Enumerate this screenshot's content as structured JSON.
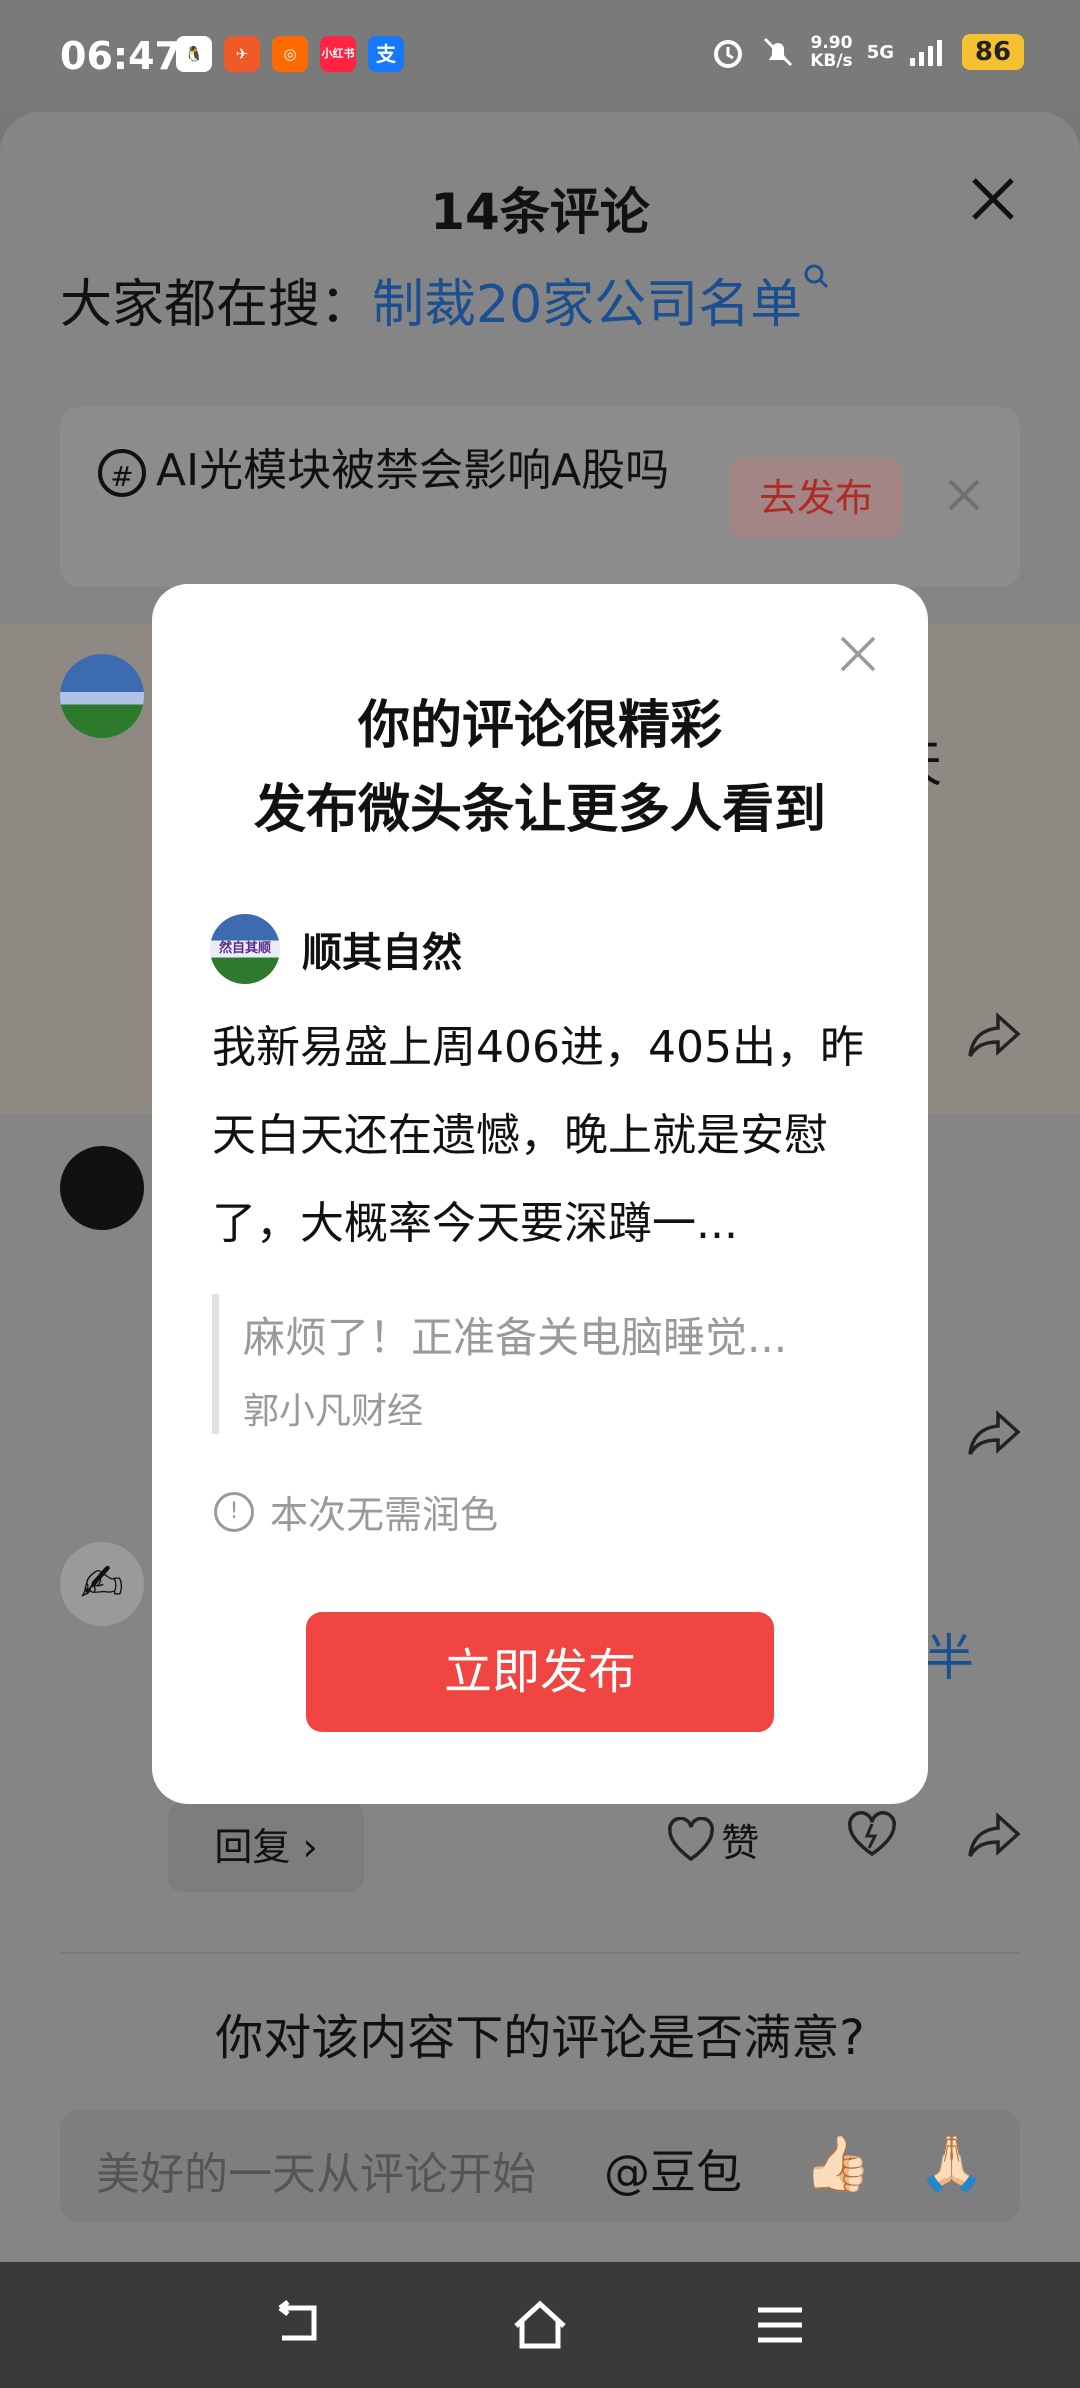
{
  "status_bar": {
    "time": "06:47",
    "net_speed_value": "9.90",
    "net_speed_unit": "KB/s",
    "network": "5G",
    "battery": "86",
    "icons": [
      "qq-icon",
      "feishu-icon",
      "kuaishou-icon",
      "xiaohongshu-icon",
      "alipay-icon",
      "alarm-icon",
      "mute-icon",
      "signal-icon"
    ],
    "app_label_1": "小红书",
    "app_label_2": "支"
  },
  "sheet": {
    "title": "14条评论",
    "hot_search_prefix": "大家都在搜：",
    "hot_search_link": "制裁20家公司名单",
    "hashtag_text": "AI光模块被禁会影响A股吗",
    "hashtag_publish": "去发布"
  },
  "background_fragments": {
    "frag1": "天",
    "frag2": "，",
    "frag3": "半",
    "reply_label": "回复",
    "like_label": "赞"
  },
  "survey": {
    "question": "你对该内容下的评论是否满意?"
  },
  "comment_input": {
    "placeholder": "美好的一天从评论开始",
    "mention": "@豆包",
    "emoji_1": "👍🏻",
    "emoji_2": "🙏🏻"
  },
  "dialog": {
    "title_line1": "你的评论很精彩",
    "title_line2": "发布微头条让更多人看到",
    "user_name": "顺其自然",
    "avatar_text": "然自其顺",
    "body": "我新易盛上周406进，405出，昨天白天还在遗憾，晚上就是安慰了，大概率今天要深蹲一...",
    "quote_text": "麻烦了！正准备关电脑睡觉...",
    "quote_source": "郭小凡财经",
    "hint": "本次无需润色",
    "publish_button": "立即发布"
  },
  "colors": {
    "accent_red": "#f04540",
    "link_blue": "#1a4f91",
    "overlay": "#858585"
  }
}
